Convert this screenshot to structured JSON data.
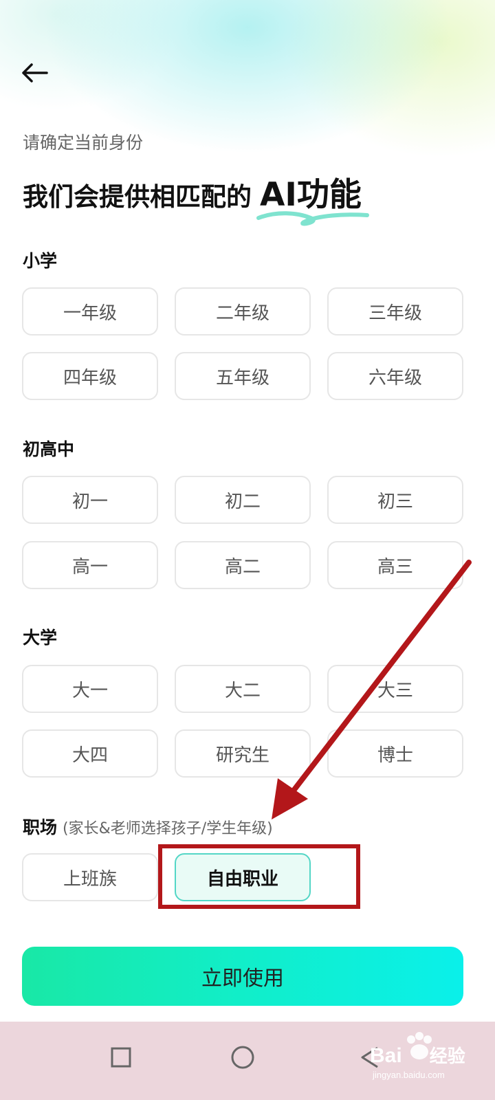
{
  "header": {
    "subtitle": "请确定当前身份",
    "headline_prefix": "我们会提供相匹配的",
    "headline_highlight": "AI功能"
  },
  "sections": [
    {
      "title": "小学",
      "options": [
        "一年级",
        "二年级",
        "三年级",
        "四年级",
        "五年级",
        "六年级"
      ]
    },
    {
      "title": "初高中",
      "options": [
        "初一",
        "初二",
        "初三",
        "高一",
        "高二",
        "高三"
      ]
    },
    {
      "title": "大学",
      "options": [
        "大一",
        "大二",
        "大三",
        "大四",
        "研究生",
        "博士"
      ]
    },
    {
      "title": "职场",
      "note": "(家长&老师选择孩子/学生年级)",
      "options": [
        "上班族",
        "自由职业"
      ],
      "selected": "自由职业"
    }
  ],
  "cta_label": "立即使用",
  "colors": {
    "accent_start": "#19e8a6",
    "accent_end": "#0af0ea",
    "selected_bg": "#e9fbf6",
    "selected_border": "#53d6c6",
    "annotation_red": "#b3171a",
    "navbar_bg": "#ecd6dc"
  },
  "navbar": {
    "icons": [
      "square-icon",
      "circle-icon",
      "back-triangle-icon"
    ]
  },
  "watermark": {
    "brand": "Bai",
    "brand_suffix": "经验",
    "url": "jingyan.baidu.com"
  }
}
